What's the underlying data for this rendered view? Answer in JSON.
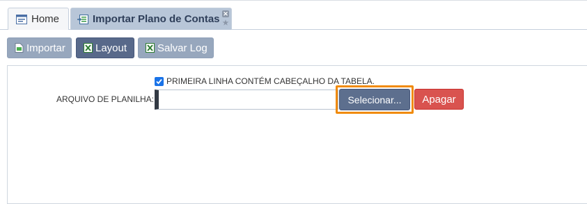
{
  "tabs": {
    "home_label": "Home",
    "import_label": "Importar Plano de Contas"
  },
  "toolbar": {
    "importar_label": "Importar",
    "layout_label": "Layout",
    "salvar_log_label": "Salvar Log"
  },
  "form": {
    "header_checkbox_label": "PRIMEIRA LINHA CONTÉM CABEÇALHO DA TABELA.",
    "header_checkbox_checked": true,
    "file_label": "ARQUIVO DE PLANILHA:",
    "file_value": "",
    "select_button_label": "Selecionar...",
    "clear_button_label": "Apagar"
  },
  "colors": {
    "active_tab": "#b8c6d8",
    "primary_button": "#5d6f8e",
    "danger_button": "#d9534f",
    "highlight": "#f08a0a"
  }
}
